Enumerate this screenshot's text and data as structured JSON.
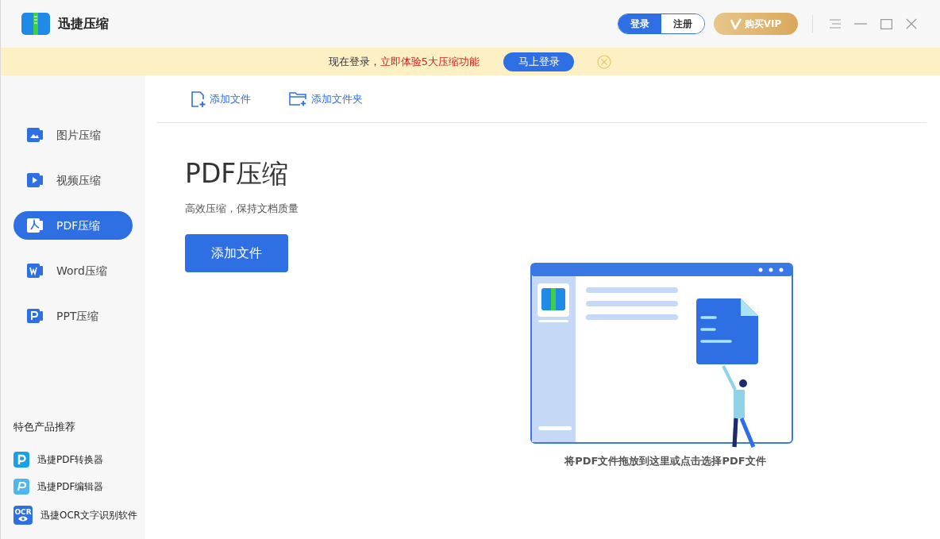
{
  "window": {
    "title": "迅捷压缩"
  },
  "account": {
    "login": "登录",
    "register": "注册",
    "vip": "购买VIP",
    "login_selected": true
  },
  "banner": {
    "text": "现在登录，",
    "highlight": "立即体验5大压缩功能",
    "button": "马上登录"
  },
  "sidebar": {
    "items": [
      {
        "label": "图片压缩",
        "kind": "image",
        "selected": false
      },
      {
        "label": "视频压缩",
        "kind": "video",
        "selected": false
      },
      {
        "label": "PDF压缩",
        "kind": "pdf",
        "selected": true
      },
      {
        "label": "Word压缩",
        "kind": "word",
        "selected": false
      },
      {
        "label": "PPT压缩",
        "kind": "ppt",
        "selected": false
      }
    ],
    "recommend_title": "特色产品推荐",
    "products": [
      {
        "label": "迅捷PDF转换器",
        "kind": "converter"
      },
      {
        "label": "迅捷PDF编辑器",
        "kind": "editor"
      },
      {
        "label": "迅捷OCR文字识别软件",
        "kind": "ocr",
        "icon_text": "OCR"
      }
    ]
  },
  "toolbar": [
    {
      "label": "添加文件",
      "kind": "file"
    },
    {
      "label": "添加文件夹",
      "kind": "folder"
    }
  ],
  "main": {
    "title": "PDF压缩",
    "subtitle": "高效压缩，保持文档质量",
    "button": "添加文件",
    "drop_hint": "将PDF文件拖放到这里或点击选择PDF文件"
  }
}
